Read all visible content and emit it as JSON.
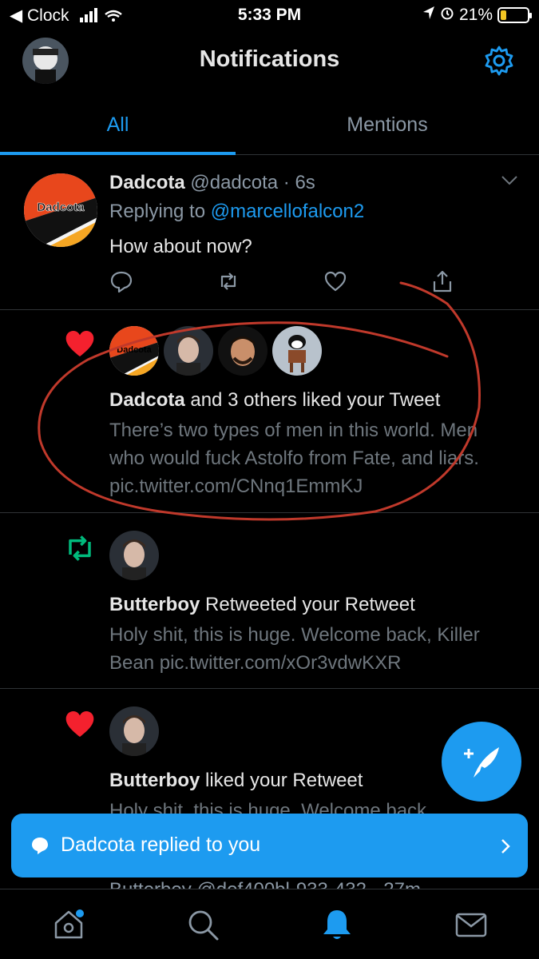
{
  "status_bar": {
    "back_app": "◀ Clock",
    "time": "5:33 PM",
    "battery": "21%",
    "battery_level": 0.21
  },
  "header": {
    "title": "Notifications"
  },
  "tabs": [
    {
      "label": "All",
      "selected": true
    },
    {
      "label": "Mentions",
      "selected": false
    }
  ],
  "tweet": {
    "author": "Dadcota",
    "handle_time": "@dadcota · 6s",
    "replying_prefix": "Replying to",
    "replying_to": "@marcellofalcon2",
    "text": "How about now?",
    "avatar_text": "Dadcota"
  },
  "notifications": [
    {
      "type": "like",
      "actor": "Dadcota",
      "action": "and 3 others liked your Tweet",
      "snippet": "There’s two types of men in this world. Men who would fuck Astolfo from Fate, and liars. pic.twitter.com/CNnq1EmmKJ",
      "avatar_text": "Dadcota"
    },
    {
      "type": "retweet",
      "actor": "Butterboy",
      "action": "Retweeted your Retweet",
      "snippet": "Holy shit, this is huge. Welcome back, Killer Bean pic.twitter.com/xOr3vdwKXR"
    },
    {
      "type": "like",
      "actor": "Butterboy",
      "action": "liked your Retweet",
      "snippet": "Holy shit, this is huge. Welcome back,"
    }
  ],
  "toast": {
    "message": "Dadcota replied to you"
  },
  "partial_next": {
    "text": "Butterboy @dof400bl·933·432 · 27m"
  },
  "colors": {
    "accent": "#1d9bf0",
    "like": "#f91880",
    "retweet": "#00ba7c",
    "annotation": "#c0392b"
  }
}
